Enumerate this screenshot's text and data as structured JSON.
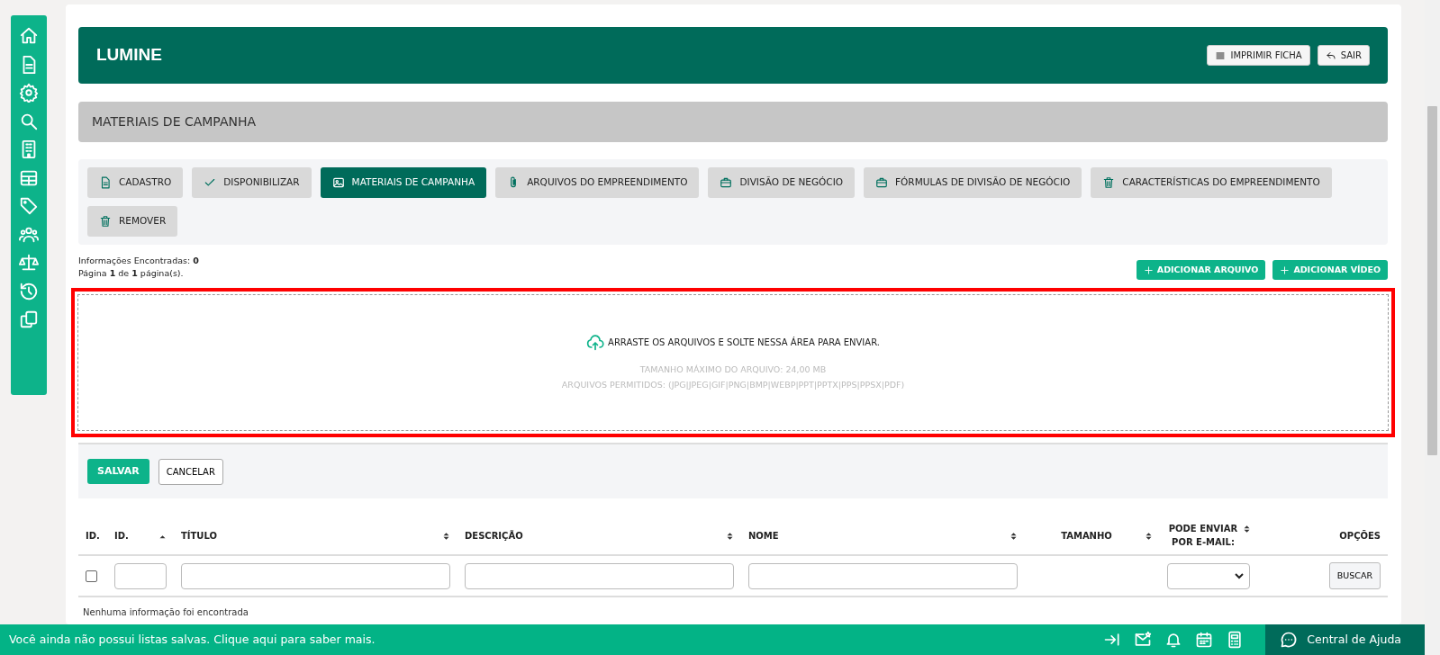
{
  "header": {
    "title": "LUMINE",
    "buttons": [
      "IMPRIMIR FICHA",
      "SAIR"
    ]
  },
  "section_title": "MATERIAIS DE CAMPANHA",
  "tabs": [
    {
      "label": "CADASTRO",
      "selected": false
    },
    {
      "label": "DISPONIBILIZAR",
      "selected": false
    },
    {
      "label": "MATERIAIS DE CAMPANHA",
      "selected": true
    },
    {
      "label": "ARQUIVOS DO EMPREENDIMENTO",
      "selected": false
    },
    {
      "label": "DIVISÃO DE NEGÓCIO",
      "selected": false
    },
    {
      "label": "FÓRMULAS DE DIVISÃO DE NEGÓCIO",
      "selected": false
    },
    {
      "label": "CARACTERÍSTICAS DO EMPREENDIMENTO",
      "selected": false
    },
    {
      "label": "REMOVER",
      "selected": false
    }
  ],
  "info": {
    "found": "Informações Encontradas: **0**",
    "page": "Página **1** de **1** página(s)."
  },
  "actions": [
    "ADICIONAR ARQUIVO",
    "ADICIONAR VÍDEO"
  ],
  "dropzone": {
    "message": "ARRASTE OS ARQUIVOS E SOLTE NESSA ÁREA PARA ENVIAR.",
    "max_size": "TAMANHO MÁXIMO DO ARQUIVO: 24,00 MB",
    "allowed": "ARQUIVOS PERMITIDOS: (JPG|JPEG|GIF|PNG|BMP|WEBP|PPT|PPTX|PPS|PPSX|PDF)"
  },
  "form_buttons": [
    {
      "label": "SALVAR",
      "kind": "primary"
    },
    {
      "label": "CANCELAR",
      "kind": "secondary"
    }
  ],
  "table": {
    "columns": [
      {
        "label": "ID.",
        "sortable": false,
        "sorted": false,
        "kind": "checkbox"
      },
      {
        "label": "ID.",
        "sorted": true,
        "kind": "text"
      },
      {
        "label": "TÍTULO",
        "sortable": true,
        "sorted": false,
        "kind": "text"
      },
      {
        "label": "DESCRIÇÃO",
        "sortable": true,
        "sorted": false,
        "kind": "text"
      },
      {
        "label": "NOME",
        "sortable": true,
        "sorted": false,
        "kind": "text"
      },
      {
        "label": "TAMANHO",
        "sortable": true,
        "sorted": false,
        "kind": "plain"
      },
      {
        "label": "PODE ENVIAR POR E-MAIL:",
        "sortable": true,
        "sorted": false,
        "kind": "select"
      },
      {
        "label": "OPÇÕES",
        "sortable": false,
        "sorted": false,
        "kind": "button",
        "button": "BUSCAR"
      }
    ],
    "checked": false,
    "empty_message": "Nenhuma informação foi encontrada"
  },
  "bottom_bar": {
    "message": "Você ainda não possui listas salvas. Clique aqui para saber mais.",
    "help": "Central de Ajuda"
  }
}
